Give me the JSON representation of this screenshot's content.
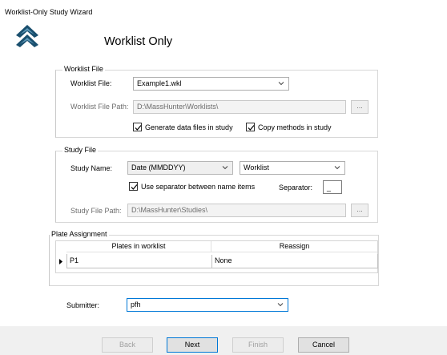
{
  "window": {
    "title": "Worklist-Only Study Wizard"
  },
  "header": {
    "title": "Worklist Only",
    "logo_icon": "double-chevron-up-icon"
  },
  "worklist_file": {
    "legend": "Worklist File",
    "file_label": "Worklist File:",
    "file_value": "Example1.wkl",
    "path_label": "Worklist File Path:",
    "path_value": "D:\\MassHunter\\Worklists\\",
    "browse_label": "...",
    "generate_label": "Generate data files in study",
    "generate_checked": true,
    "copy_label": "Copy methods in study",
    "copy_checked": true
  },
  "study_file": {
    "legend": "Study File",
    "name_label": "Study Name:",
    "name_format": "Date (MMDDYY)",
    "name_suffix": "Worklist",
    "use_separator_label": "Use separator between name items",
    "use_separator_checked": true,
    "separator_label": "Separator:",
    "separator_value": "_",
    "path_label": "Study File Path:",
    "path_value": "D:\\MassHunter\\Studies\\",
    "browse_label": "..."
  },
  "plate_assignment": {
    "legend": "Plate Assignment",
    "columns": [
      "Plates in worklist",
      "Reassign"
    ],
    "rows": [
      {
        "plate": "P1",
        "reassign": "None"
      }
    ]
  },
  "submitter": {
    "label": "Submitter:",
    "value": "pfh"
  },
  "buttons": {
    "back": "Back",
    "next": "Next",
    "finish": "Finish",
    "cancel": "Cancel"
  },
  "colors": {
    "accent": "#0078d7",
    "logo": "#1a4f6e"
  }
}
